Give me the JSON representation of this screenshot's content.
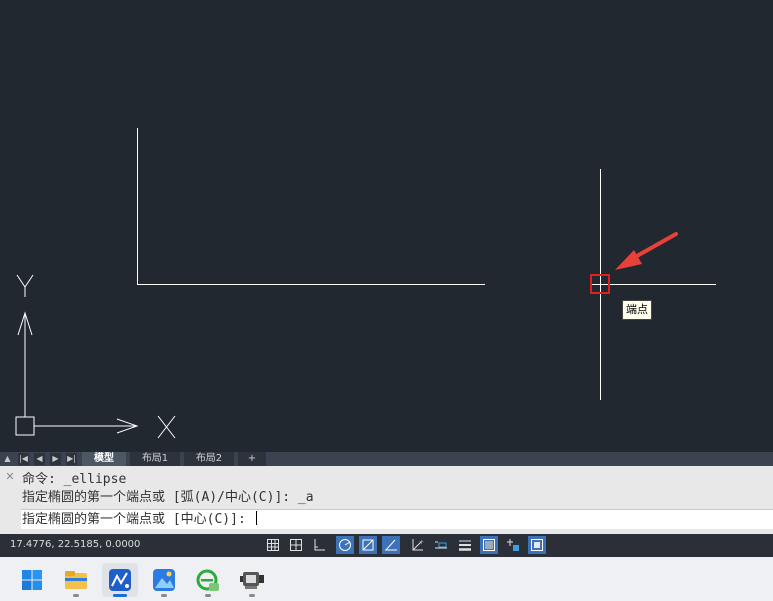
{
  "canvas": {
    "tooltip": "端点",
    "x_axis_label": "X",
    "y_axis_label": "Y",
    "background": "#212830"
  },
  "layout_tabs": {
    "tabs": [
      {
        "label": "模型",
        "active": true
      },
      {
        "label": "布局1",
        "active": false
      },
      {
        "label": "布局2",
        "active": false
      },
      {
        "label": "+",
        "active": false
      }
    ]
  },
  "command": {
    "history": [
      "命令: _ellipse",
      "指定椭圆的第一个端点或 [弧(A)/中心(C)]: _a"
    ],
    "prompt": "指定椭圆的第一个端点或 [中心(C)]: "
  },
  "status": {
    "coordinates": "17.4776, 22.5185, 0.0000",
    "toggles": [
      {
        "icon": "grid-icon",
        "on": false
      },
      {
        "icon": "snap-grid-icon",
        "on": false
      },
      {
        "icon": "ortho-icon",
        "on": false
      },
      {
        "icon": "polar-icon",
        "on": true
      },
      {
        "icon": "osnap-icon",
        "on": true
      },
      {
        "icon": "otrack-icon",
        "on": true
      },
      {
        "icon": "dynamic-ucs-icon",
        "on": false
      },
      {
        "icon": "dynamic-input-icon",
        "on": false
      },
      {
        "icon": "lineweight-icon",
        "on": false
      },
      {
        "icon": "transparency-icon",
        "on": true
      },
      {
        "icon": "selection-cycling-icon",
        "on": false
      },
      {
        "icon": "annotation-monitor-icon",
        "on": true
      }
    ]
  },
  "taskbar": {
    "apps": [
      {
        "icon": "windows-start-icon"
      },
      {
        "icon": "file-explorer-icon"
      },
      {
        "icon": "cad-app-icon",
        "active": true
      },
      {
        "icon": "photos-icon"
      },
      {
        "icon": "browser-icon"
      },
      {
        "icon": "media-tool-icon"
      }
    ]
  }
}
